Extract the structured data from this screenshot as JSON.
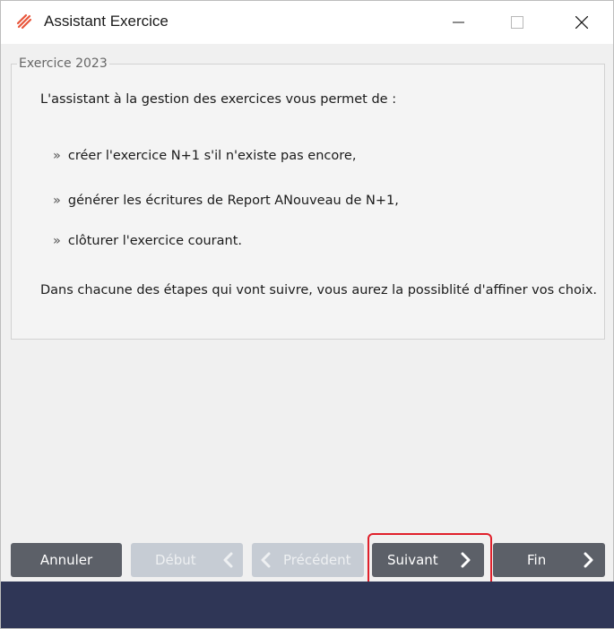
{
  "window": {
    "title": "Assistant Exercice",
    "icons": [
      "app-logo-icon",
      "minimize-icon",
      "maximize-icon",
      "close-icon"
    ]
  },
  "group": {
    "legend": "Exercice 2023",
    "intro": "L'assistant à la gestion des exercices vous permet de :",
    "bullet_mark": "»",
    "bullets": [
      "créer l'exercice N+1 s'il n'existe pas encore,",
      "générer les écritures de Report ANouveau de N+1,",
      "clôturer l'exercice courant."
    ],
    "outro": "Dans chacune des étapes qui vont suivre, vous aurez la possiblité d'affiner vos choix."
  },
  "buttons": {
    "cancel": "Annuler",
    "start": "Début",
    "previous": "Précédent",
    "next": "Suivant",
    "finish": "Fin"
  },
  "colors": {
    "button_active": "#5c6068",
    "button_disabled": "#c6ccd4",
    "highlight": "#e0202b",
    "footer": "#2f3656",
    "app_icon": "#e8553a"
  }
}
